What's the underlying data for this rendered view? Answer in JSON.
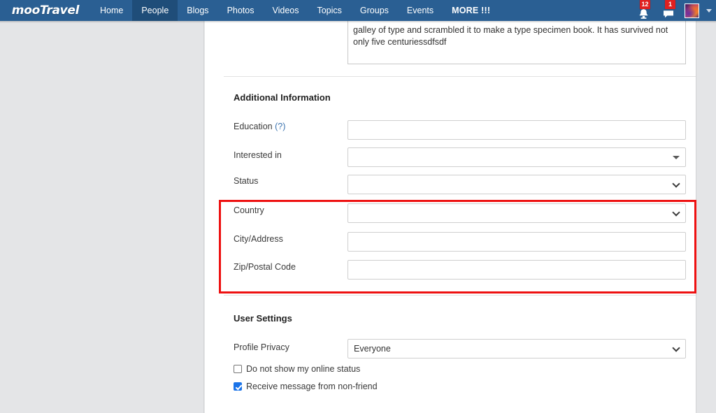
{
  "header": {
    "logo": "mooTravel",
    "nav_items": [
      {
        "label": "Home",
        "active": false
      },
      {
        "label": "People",
        "active": true
      },
      {
        "label": "Blogs",
        "active": false
      },
      {
        "label": "Photos",
        "active": false
      },
      {
        "label": "Videos",
        "active": false
      },
      {
        "label": "Topics",
        "active": false
      },
      {
        "label": "Groups",
        "active": false
      },
      {
        "label": "Events",
        "active": false
      },
      {
        "label": "MORE !!!",
        "active": false
      }
    ],
    "notifications_badge": "12",
    "messages_badge": "1",
    "brand_color": "#2a5f93",
    "active_color": "#1f4d79",
    "badge_color": "#e02020"
  },
  "about_textarea": {
    "value": "galley of type and scrambled it to make a type specimen book. It has survived not only five centuriessdfsdf"
  },
  "additional_information": {
    "title": "Additional Information",
    "fields": [
      {
        "label": "Education",
        "hint": "(?)",
        "type": "text",
        "value": ""
      },
      {
        "label": "Interested in",
        "type": "select",
        "value": ""
      },
      {
        "label": "Status",
        "type": "select",
        "value": ""
      },
      {
        "label": "Country",
        "type": "select",
        "value": ""
      },
      {
        "label": "City/Address",
        "type": "text",
        "value": ""
      },
      {
        "label": "Zip/Postal Code",
        "type": "text",
        "value": ""
      }
    ]
  },
  "highlight": {
    "color": "#ee1111",
    "covers": [
      "Country",
      "City/Address",
      "Zip/Postal Code"
    ]
  },
  "user_settings": {
    "title": "User Settings",
    "profile_privacy": {
      "label": "Profile Privacy",
      "value": "Everyone"
    },
    "checkboxes": [
      {
        "label": "Do not show my online status",
        "checked": false
      },
      {
        "label": "Receive message from non-friend",
        "checked": true
      }
    ]
  }
}
